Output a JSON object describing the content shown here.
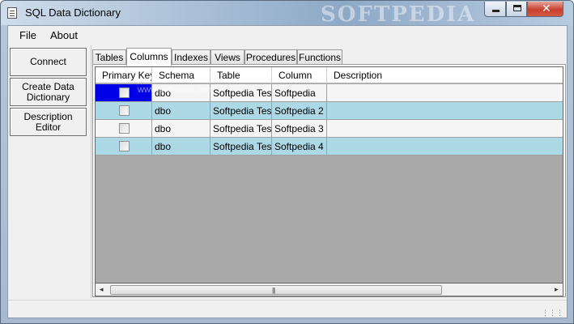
{
  "window": {
    "title": "SQL Data Dictionary",
    "watermark": "SOFTPEDIA",
    "minimize_label": "",
    "maximize_label": "",
    "close_label": "✕"
  },
  "menu": {
    "items": [
      "File",
      "About"
    ]
  },
  "sidebar": {
    "buttons": [
      "Connect",
      "Create Data Dictionary",
      "Description Editor"
    ]
  },
  "tabs": [
    "Tables",
    "Columns",
    "Indexes",
    "Views",
    "Procedures",
    "Functions"
  ],
  "active_tab": "Columns",
  "grid": {
    "columns": [
      "Primary Key",
      "Schema",
      "Table",
      "Column",
      "Description"
    ],
    "rows": [
      {
        "primary_key": false,
        "schema": "dbo",
        "table": "Softpedia Test",
        "column": "Softpedia",
        "description": ""
      },
      {
        "primary_key": false,
        "schema": "dbo",
        "table": "Softpedia Test",
        "column": "Softpedia 2",
        "description": ""
      },
      {
        "primary_key": false,
        "schema": "dbo",
        "table": "Softpedia Test",
        "column": "Softpedia 3",
        "description": ""
      },
      {
        "primary_key": false,
        "schema": "dbo",
        "table": "Softpedia Test",
        "column": "Softpedia 4",
        "description": ""
      }
    ],
    "overlay_watermark": "www.softpedia.com"
  },
  "scrollbar": {
    "left_arrow": "◂",
    "right_arrow": "▸",
    "grip": "|||"
  },
  "colors": {
    "row_alt": "#add8e6",
    "selection": "#0000e6"
  }
}
